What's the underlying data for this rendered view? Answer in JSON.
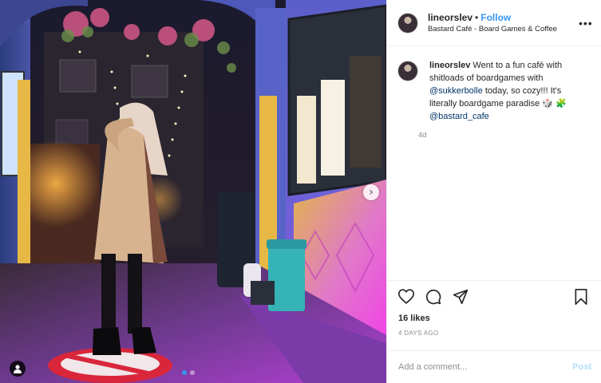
{
  "header": {
    "username": "lineorslev",
    "separator": "•",
    "follow_label": "Follow",
    "location": "Bastard Café - Board Games & Coffee",
    "more_icon": "ellipsis-icon",
    "more_label": "•••"
  },
  "caption": {
    "username": "lineorslev",
    "text1": "Went to a fun café with shitloads of boardgames with",
    "mention1": "@sukkerbolle",
    "text2": "today, so cozy!!! It's literally boardgame paradise 🎲 🧩",
    "mention2": "@bastard_cafe",
    "age": "4d"
  },
  "media": {
    "next_label": "›",
    "carousel_count": 2,
    "carousel_active": 0
  },
  "actions": {
    "icons": [
      "heart-icon",
      "comment-icon",
      "share-icon",
      "bookmark-icon"
    ]
  },
  "likes": "16 likes",
  "timestamp": "4 DAYS AGO",
  "comment_box": {
    "placeholder": "Add a comment...",
    "post_label": "Post"
  },
  "colors": {
    "accent": "#3897f0",
    "post_disabled": "#b2dffc",
    "divider": "#efefef"
  }
}
